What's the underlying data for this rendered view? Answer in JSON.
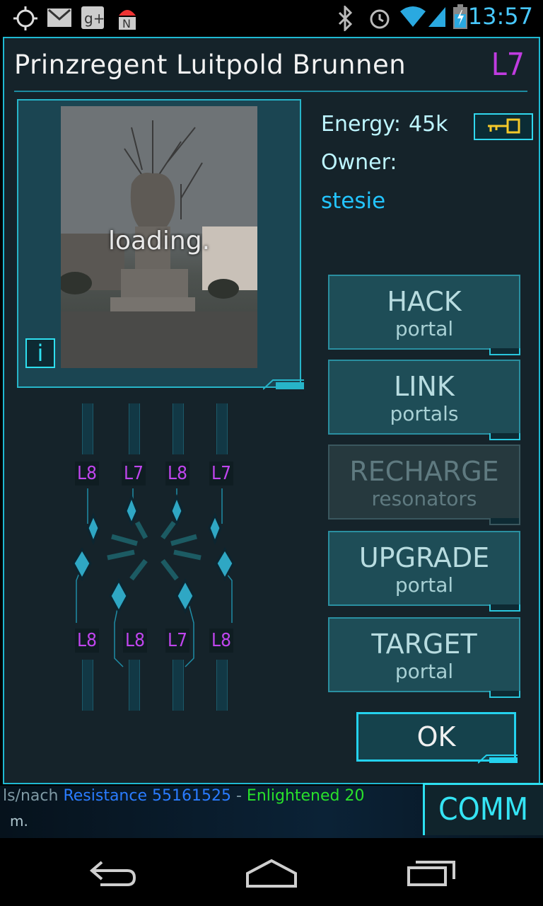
{
  "status_bar": {
    "time": "13:57",
    "icons": [
      "gps-icon",
      "gmail-icon",
      "google-plus-icon",
      "ingress-icon",
      "bluetooth-icon",
      "alarm-icon",
      "wifi-icon",
      "cell-signal-icon",
      "battery-charging-icon"
    ]
  },
  "portal": {
    "name": "Prinzregent Luitpold Brunnen",
    "level": "L7",
    "image_status": "loading.",
    "info_icon_label": "i",
    "energy_label": "Energy:",
    "energy_value": "45k",
    "owner_label": "Owner:",
    "owner_name": "stesie"
  },
  "resonators": {
    "top_levels": [
      "L8",
      "L7",
      "L8",
      "L7"
    ],
    "bottom_levels": [
      "L8",
      "L8",
      "L7",
      "L8"
    ]
  },
  "actions": [
    {
      "line1": "HACK",
      "line2": "portal",
      "enabled": true
    },
    {
      "line1": "LINK",
      "line2": "portals",
      "enabled": true
    },
    {
      "line1": "RECHARGE",
      "line2": "resonators",
      "enabled": false
    },
    {
      "line1": "UPGRADE",
      "line2": "portal",
      "enabled": true
    },
    {
      "line1": "TARGET",
      "line2": "portal",
      "enabled": true
    }
  ],
  "ok_label": "OK",
  "comm": {
    "label": "COMM",
    "feed_prefix": "ls/nach",
    "feed_resistance": "Resistance 55161525",
    "feed_dash": " - ",
    "feed_enlightened": "Enlightened 20",
    "feed_line2": "m."
  },
  "colors": {
    "accent": "#1fb9d2",
    "level_purple": "#c03ce0",
    "owner_blue": "#23c4ff",
    "resistance_blue": "#2a7cff",
    "enlightened_green": "#29e12b"
  }
}
